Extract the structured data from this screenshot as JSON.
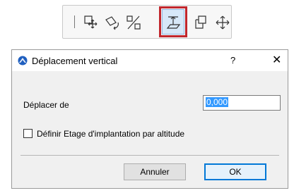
{
  "toolbar": {
    "icons": [
      "move-icon",
      "rotate-icon",
      "mirror-icon",
      "elevate-icon",
      "multiply-icon",
      "drag-icon"
    ],
    "active_icon": "elevate-icon",
    "highlight_color": "#c1272d"
  },
  "dialog": {
    "title": "Déplacement vertical",
    "help_label": "?",
    "close_label": "✕",
    "move_label": "Déplacer de",
    "move_value": "0,000",
    "checkbox_label": "Définir Etage d'implantation par altitude",
    "checkbox_checked": false,
    "cancel_label": "Annuler",
    "ok_label": "OK",
    "accent_color": "#0078d7"
  }
}
